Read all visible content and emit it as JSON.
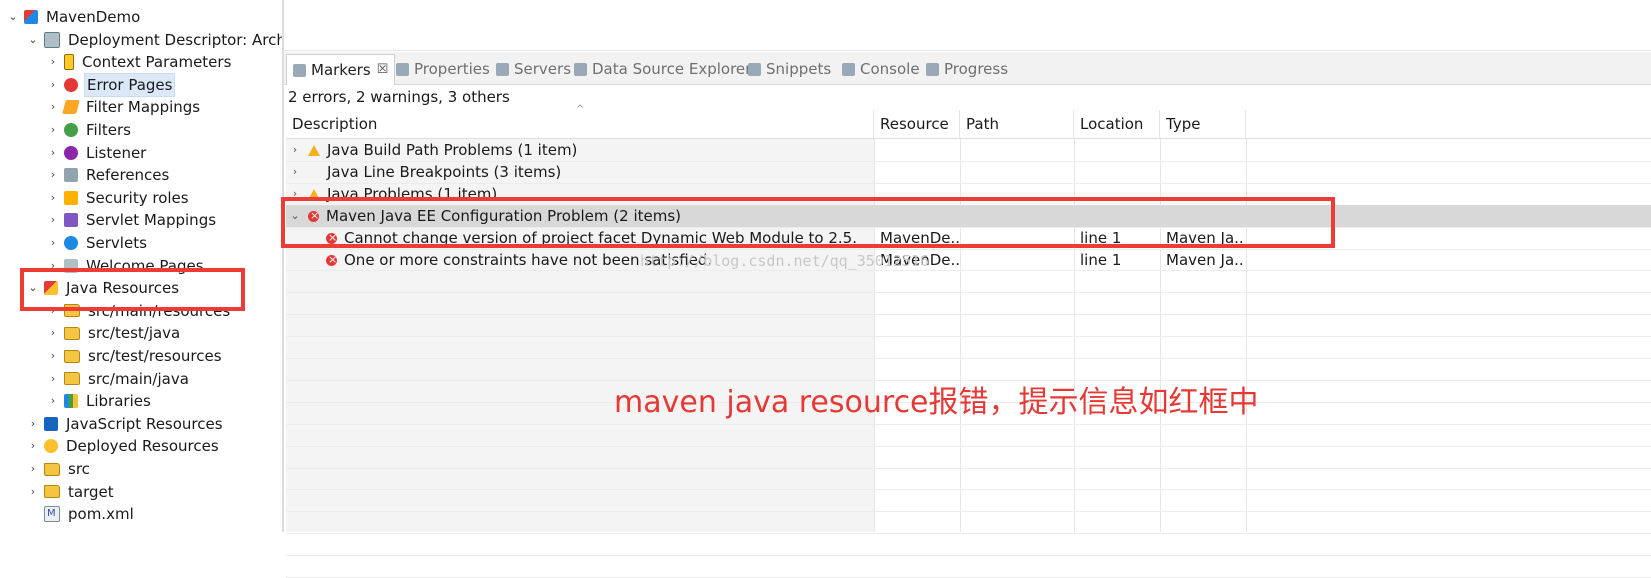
{
  "explorer": {
    "items": [
      {
        "label": "MavenDemo",
        "toggle": "⌄",
        "icon": "project-icon",
        "cls": "ic-project",
        "indent": 0,
        "selected": false
      },
      {
        "label": "Deployment Descriptor: Archetype Created Web Application",
        "toggle": "⌄",
        "icon": "web-descriptor-icon",
        "cls": "ic-web",
        "indent": 1,
        "selected": false
      },
      {
        "label": "Context Parameters",
        "toggle": "›",
        "icon": "context-param-icon",
        "cls": "ic-ctx",
        "indent": 2,
        "selected": false
      },
      {
        "label": "Error Pages",
        "toggle": "›",
        "icon": "error-icon",
        "cls": "ic-err",
        "indent": 2,
        "selected": true
      },
      {
        "label": "Filter Mappings",
        "toggle": "›",
        "icon": "filter-mapping-icon",
        "cls": "ic-filtermap",
        "indent": 2,
        "selected": false
      },
      {
        "label": "Filters",
        "toggle": "›",
        "icon": "filter-icon",
        "cls": "ic-filter",
        "indent": 2,
        "selected": false
      },
      {
        "label": "Listener",
        "toggle": "›",
        "icon": "listener-icon",
        "cls": "ic-listener",
        "indent": 2,
        "selected": false
      },
      {
        "label": "References",
        "toggle": "›",
        "icon": "references-icon",
        "cls": "ic-ref",
        "indent": 2,
        "selected": false
      },
      {
        "label": "Security roles",
        "toggle": "›",
        "icon": "security-icon",
        "cls": "ic-sec",
        "indent": 2,
        "selected": false
      },
      {
        "label": "Servlet Mappings",
        "toggle": "›",
        "icon": "servlet-mapping-icon",
        "cls": "ic-servmap",
        "indent": 2,
        "selected": false
      },
      {
        "label": "Servlets",
        "toggle": "›",
        "icon": "servlet-icon",
        "cls": "ic-serv",
        "indent": 2,
        "selected": false
      },
      {
        "label": "Welcome Pages",
        "toggle": "›",
        "icon": "welcome-pages-icon",
        "cls": "ic-welcome",
        "indent": 2,
        "selected": false
      },
      {
        "label": "Java Resources",
        "toggle": "⌄",
        "icon": "java-resources-icon",
        "cls": "ic-javares",
        "indent": 1,
        "selected": false
      },
      {
        "label": "src/main/resources",
        "toggle": "›",
        "icon": "source-folder-icon",
        "cls": "ic-folder",
        "indent": 2,
        "selected": false
      },
      {
        "label": "src/test/java",
        "toggle": "›",
        "icon": "source-folder-icon",
        "cls": "ic-folder",
        "indent": 2,
        "selected": false
      },
      {
        "label": "src/test/resources",
        "toggle": "›",
        "icon": "source-folder-icon",
        "cls": "ic-folder",
        "indent": 2,
        "selected": false
      },
      {
        "label": "src/main/java",
        "toggle": "›",
        "icon": "source-folder-icon",
        "cls": "ic-folder",
        "indent": 2,
        "selected": false
      },
      {
        "label": "Libraries",
        "toggle": "›",
        "icon": "libraries-icon",
        "cls": "ic-lib",
        "indent": 2,
        "selected": false
      },
      {
        "label": "JavaScript Resources",
        "toggle": "›",
        "icon": "javascript-resources-icon",
        "cls": "ic-js",
        "indent": 1,
        "selected": false
      },
      {
        "label": "Deployed Resources",
        "toggle": "›",
        "icon": "deployed-resources-icon",
        "cls": "ic-deployed",
        "indent": 1,
        "selected": false
      },
      {
        "label": "src",
        "toggle": "›",
        "icon": "folder-icon",
        "cls": "ic-folder",
        "indent": 1,
        "selected": false
      },
      {
        "label": "target",
        "toggle": "›",
        "icon": "folder-icon",
        "cls": "ic-folder",
        "indent": 1,
        "selected": false
      },
      {
        "label": "pom.xml",
        "toggle": "",
        "icon": "xml-file-icon",
        "cls": "ic-xml",
        "indent": 1,
        "selected": false
      }
    ]
  },
  "tabs": [
    {
      "label": "Markers",
      "icon": "markers-icon",
      "active": true,
      "close": "☒"
    },
    {
      "label": "Properties",
      "icon": "properties-icon",
      "active": false
    },
    {
      "label": "Servers",
      "icon": "servers-icon",
      "active": false
    },
    {
      "label": "Data Source Explorer",
      "icon": "data-source-icon",
      "active": false
    },
    {
      "label": "Snippets",
      "icon": "snippets-icon",
      "active": false
    },
    {
      "label": "Console",
      "icon": "console-icon",
      "active": false
    },
    {
      "label": "Progress",
      "icon": "progress-icon",
      "active": false
    }
  ],
  "markers": {
    "summary": "2 errors, 2 warnings, 3 others",
    "columns": [
      "Description",
      "Resource",
      "Path",
      "Location",
      "Type"
    ],
    "sort_indicator": "^",
    "rows": [
      {
        "expander": "›",
        "icon": "warning",
        "description": "Java Build Path Problems (1 item)",
        "resource": "",
        "path": "",
        "location": "",
        "type": "",
        "level": 0,
        "highlight": false
      },
      {
        "expander": "›",
        "icon": "",
        "description": "Java Line Breakpoints (3 items)",
        "resource": "",
        "path": "",
        "location": "",
        "type": "",
        "level": 0,
        "highlight": false
      },
      {
        "expander": "›",
        "icon": "warning",
        "description": "Java Problems (1 item)",
        "resource": "",
        "path": "",
        "location": "",
        "type": "",
        "level": 0,
        "highlight": false
      },
      {
        "expander": "⌄",
        "icon": "error",
        "description": "Maven Java EE Configuration Problem (2 items)",
        "resource": "",
        "path": "",
        "location": "",
        "type": "",
        "level": 0,
        "highlight": true
      },
      {
        "expander": "",
        "icon": "error",
        "description": "Cannot change version of project facet Dynamic Web Module to 2.5.",
        "resource": "MavenDe...",
        "path": "",
        "location": "line 1",
        "type": "Maven Ja...",
        "level": 1,
        "highlight": false
      },
      {
        "expander": "",
        "icon": "error",
        "description": "One or more constraints have not been satisfied.",
        "resource": "MavenDe...",
        "path": "",
        "location": "line 1",
        "type": "Maven Ja...",
        "level": 1,
        "highlight": false
      }
    ]
  },
  "watermark": "http://blog.csdn.net/qq_35012516",
  "annotation": "maven java resource报错，提示信息如红框中",
  "colors": {
    "annotation": "#e53935",
    "redbox": "#ef3b36",
    "highlight_row": "#d8d8d8"
  }
}
